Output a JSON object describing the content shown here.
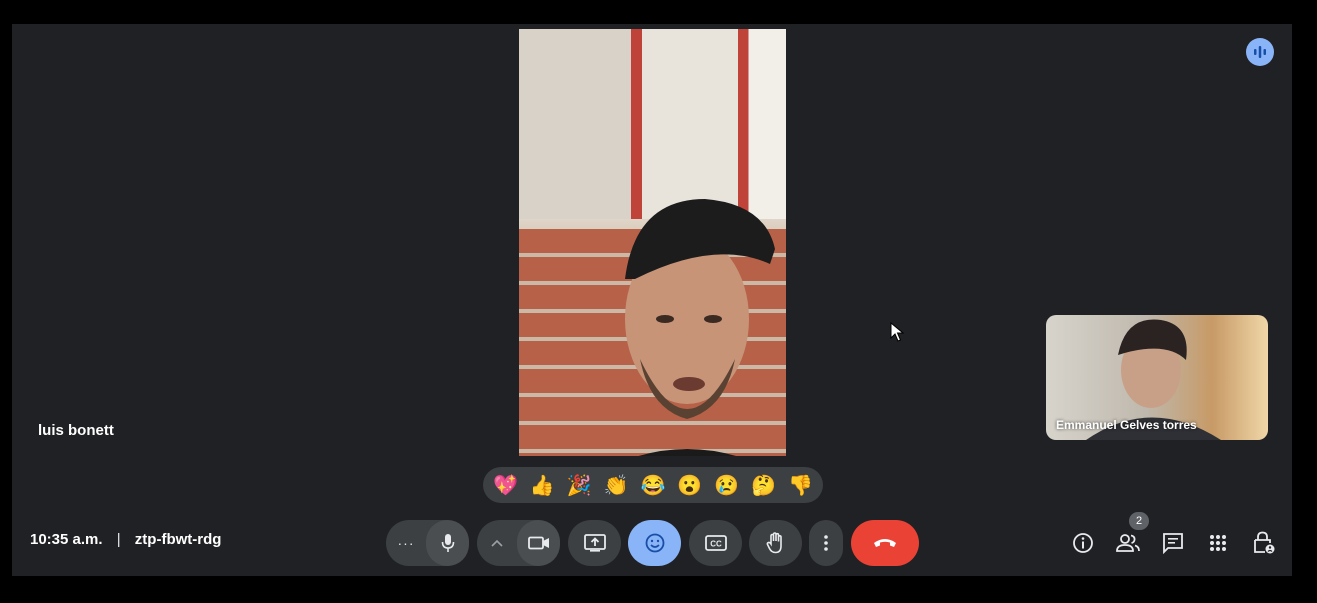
{
  "meeting": {
    "time": "10:35 a.m.",
    "separator": "|",
    "code": "ztp-fbwt-rdg"
  },
  "participants": {
    "main_name": "luis bonett",
    "pip_name": "Emmanuel Gelves torres",
    "count_badge": "2"
  },
  "reactions": [
    {
      "name": "sparkling-heart",
      "glyph": "💖"
    },
    {
      "name": "thumbs-up",
      "glyph": "👍"
    },
    {
      "name": "party-popper",
      "glyph": "🎉"
    },
    {
      "name": "clapping-hands",
      "glyph": "👏"
    },
    {
      "name": "tears-of-joy",
      "glyph": "😂"
    },
    {
      "name": "surprised",
      "glyph": "😮"
    },
    {
      "name": "crying",
      "glyph": "😢"
    },
    {
      "name": "thinking",
      "glyph": "🤔"
    },
    {
      "name": "thumbs-down",
      "glyph": "👎"
    }
  ],
  "controls": {
    "more_audio": "···",
    "icons": [
      "microphone-icon",
      "chevron-up-icon",
      "camera-icon",
      "present-screen-icon",
      "emoji-icon",
      "captions-icon",
      "raise-hand-icon",
      "more-options-icon",
      "end-call-icon"
    ]
  },
  "colors": {
    "background": "#202124",
    "control": "#3c4043",
    "active_control": "#8ab4f8",
    "end_call": "#ea4335"
  }
}
